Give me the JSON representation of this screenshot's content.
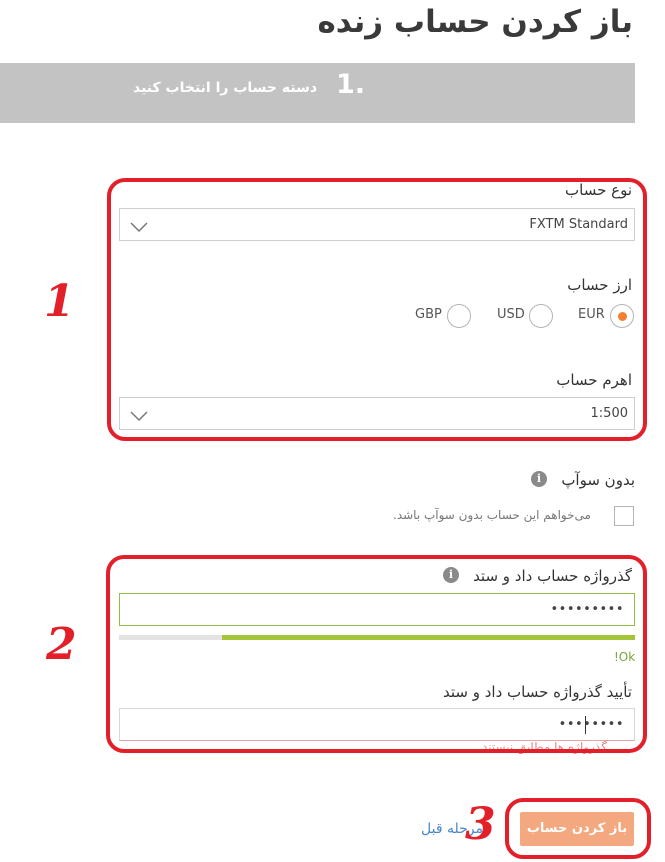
{
  "page": {
    "title": "باز کردن حساب زنده"
  },
  "step": {
    "number": "1.",
    "label": "دسته حساب را انتخاب کنید"
  },
  "account_type": {
    "label": "نوع حساب",
    "value": "FXTM Standard"
  },
  "currency": {
    "label": "ارز حساب",
    "options": [
      {
        "label": "EUR",
        "selected": true
      },
      {
        "label": "USD",
        "selected": false
      },
      {
        "label": "GBP",
        "selected": false
      }
    ]
  },
  "leverage": {
    "label": "اهرم حساب",
    "value": "1:500"
  },
  "swap_free": {
    "label": "بدون سوآپ",
    "checkbox_label": "می‌خواهم این حساب بدون سوآپ باشد.",
    "checked": false
  },
  "password": {
    "label": "گذرواژه حساب داد و ستد",
    "value": "•••••••••",
    "strength": 0.8,
    "strength_text": "!Ok",
    "strength_color": "#a4c53a"
  },
  "confirm_password": {
    "label": "تأیید گذرواژه حساب داد و ستد",
    "value": "••••••••",
    "error": "گذرواژه ها مطابق نیستند"
  },
  "actions": {
    "prev_label": "مرحله قبل",
    "submit_label": "باز کردن حساب"
  },
  "annotations": {
    "box1": "1",
    "box2": "2",
    "box3": "3"
  },
  "colors": {
    "accent": "#f27f32",
    "button": "#f4a880",
    "annotation": "#e3202a",
    "banner": "#c3c3c3"
  }
}
